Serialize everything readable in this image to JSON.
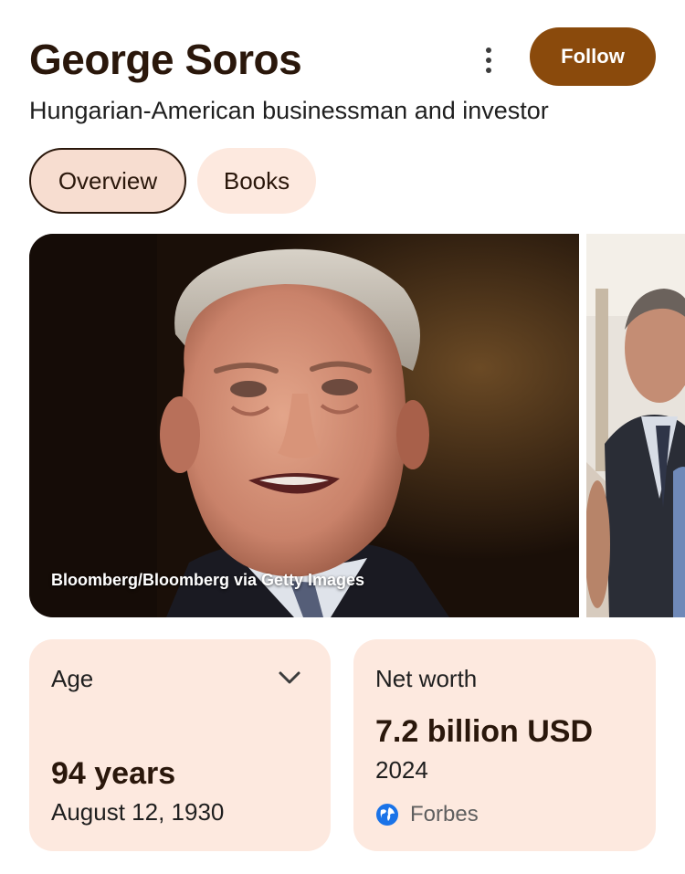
{
  "header": {
    "title": "George Soros",
    "subtitle": "Hungarian-American businessman and investor",
    "follow_label": "Follow",
    "more_icon": "more-vert-icon"
  },
  "tabs": [
    {
      "label": "Overview",
      "active": true
    },
    {
      "label": "Books",
      "active": false
    }
  ],
  "gallery": {
    "main_photo_credit": "Bloomberg/Bloomberg via Getty Images"
  },
  "facts": {
    "age": {
      "label": "Age",
      "value": "94 years",
      "detail": "August 12, 1930",
      "icon": "chevron-down-icon"
    },
    "net_worth": {
      "label": "Net worth",
      "value": "7.2 billion USD",
      "detail": "2024",
      "source": "Forbes",
      "source_icon": "globe-icon"
    }
  },
  "colors": {
    "accent": "#8a4a0c",
    "title": "#2a170b",
    "chip_active_bg": "#f7ddd0",
    "chip_bg": "#fde9df",
    "card_bg": "#fde9df"
  }
}
